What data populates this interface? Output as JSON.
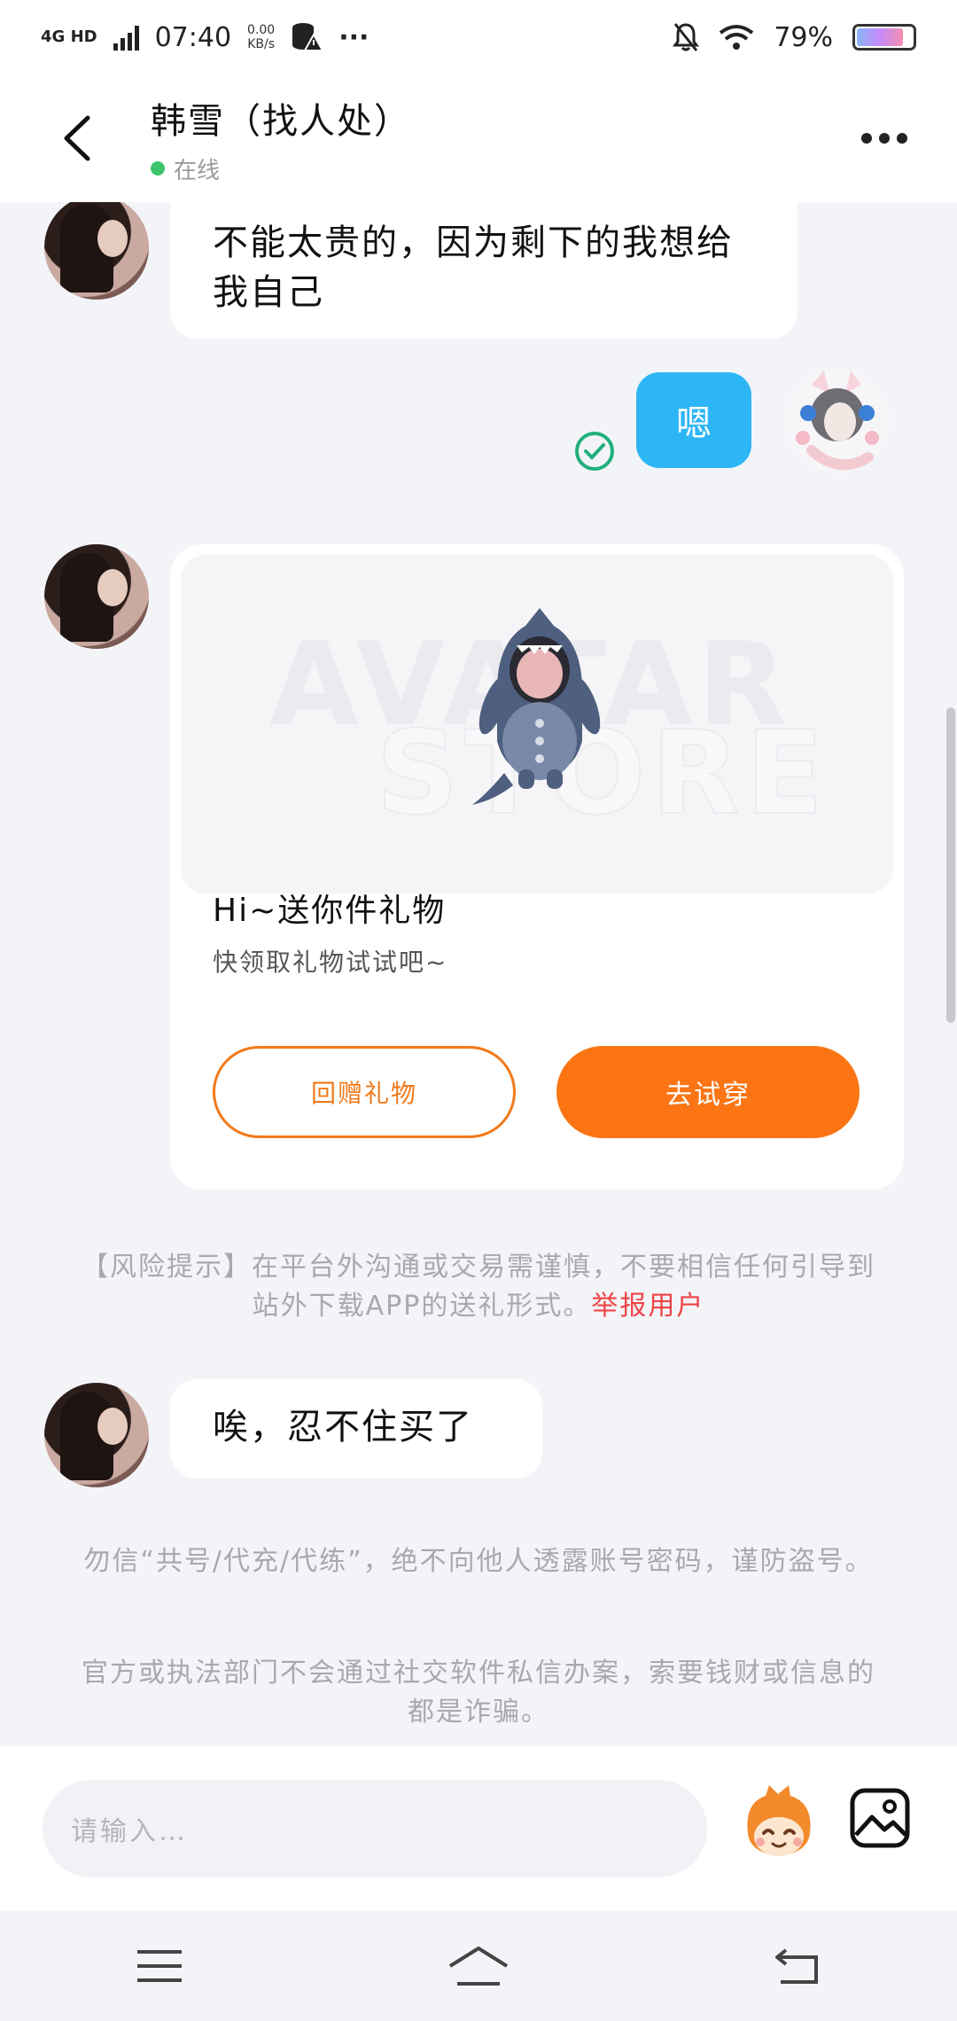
{
  "status_bar": {
    "network": "4G HD",
    "time": "07:40",
    "speed_value": "0.00",
    "speed_unit": "KB/s",
    "more": "···",
    "battery_text": "79%",
    "battery_level": 0.79
  },
  "header": {
    "title": "韩雪（找人处）",
    "status": "在线"
  },
  "messages": {
    "msg1": "不能太贵的，因为剩下的我想给我自己",
    "msg2": "嗯",
    "msg3": "唉，忍不住买了"
  },
  "gift_card": {
    "banner_text_1": "AVATAR",
    "banner_text_2": "STORE",
    "title": "Hi~送你件礼物",
    "subtitle": "快领取礼物试试吧~",
    "btn_return": "回赠礼物",
    "btn_try": "去试穿"
  },
  "notices": {
    "risk_text": "【风险提示】在平台外沟通或交易需谨慎，不要相信任何引导到站外下载APP的送礼形式。",
    "risk_link": "举报用户",
    "account_warning": "勿信“共号/代充/代练”，绝不向他人透露账号密码，谨防盗号。",
    "fraud_warning": "官方或执法部门不会通过社交软件私信办案，索要钱财或信息的都是诈骗。"
  },
  "input": {
    "placeholder": "请输入…"
  },
  "colors": {
    "accent_orange": "#fb7514",
    "bubble_blue": "#2db6f5",
    "online_green": "#3cc46b",
    "report_red": "#ef4444"
  }
}
